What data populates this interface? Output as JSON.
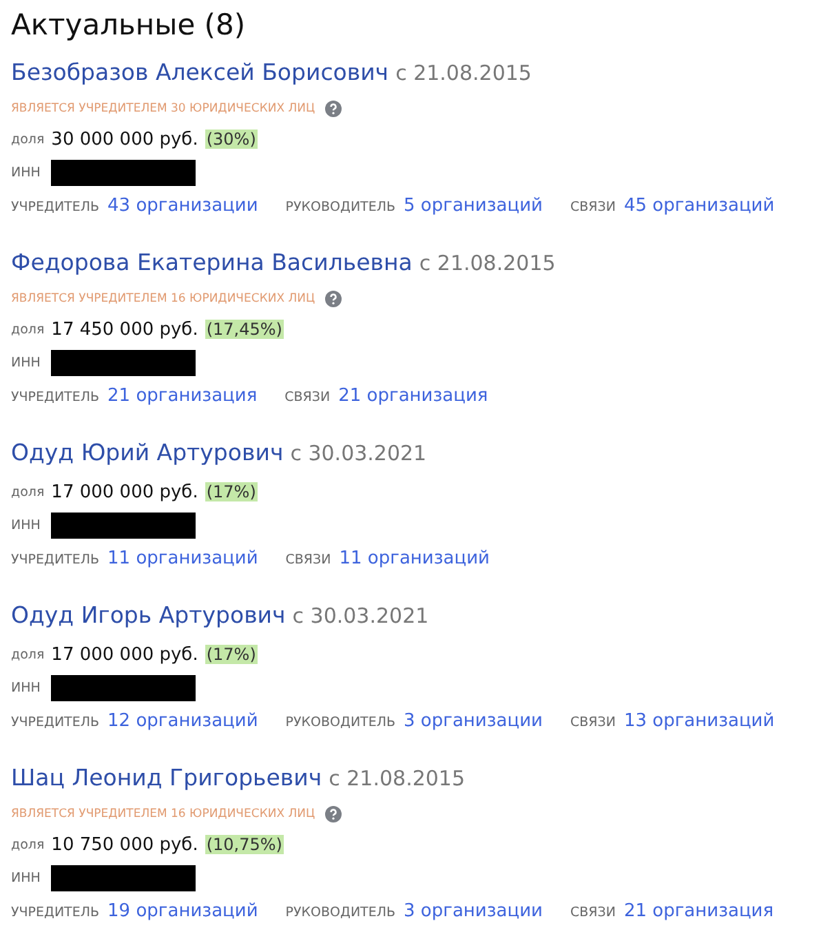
{
  "heading": "Актуальные (8)",
  "persons": [
    {
      "name": "Безобразов Алексей Борисович",
      "since": "с 21.08.2015",
      "note": "ЯВЛЯЕТСЯ УЧРЕДИТЕЛЕМ 30 ЮРИДИЧЕСКИХ ЛИЦ",
      "share_label": "доля",
      "share": "30 000 000 руб.",
      "percent": "(30%)",
      "inn_label": "ИНН",
      "inn_redacted": true,
      "links": [
        {
          "label": "УЧРЕДИТЕЛЬ",
          "value": "43 организации"
        },
        {
          "label": "РУКОВОДИТЕЛЬ",
          "value": "5 организаций"
        },
        {
          "label": "СВЯЗИ",
          "value": "45 организаций"
        }
      ]
    },
    {
      "name": "Федорова Екатерина Васильевна",
      "since": "с 21.08.2015",
      "note": "ЯВЛЯЕТСЯ УЧРЕДИТЕЛЕМ 16 ЮРИДИЧЕСКИХ ЛИЦ",
      "share_label": "доля",
      "share": "17 450 000 руб.",
      "percent": "(17,45%)",
      "inn_label": "ИНН",
      "inn_redacted": true,
      "links": [
        {
          "label": "УЧРЕДИТЕЛЬ",
          "value": "21 организация"
        },
        {
          "label": "СВЯЗИ",
          "value": "21 организация"
        }
      ]
    },
    {
      "name": "Одуд Юрий Артурович",
      "since": "с 30.03.2021",
      "share_label": "доля",
      "share": "17 000 000 руб.",
      "percent": "(17%)",
      "inn_label": "ИНН",
      "inn_redacted": true,
      "links": [
        {
          "label": "УЧРЕДИТЕЛЬ",
          "value": "11 организаций"
        },
        {
          "label": "СВЯЗИ",
          "value": "11 организаций"
        }
      ]
    },
    {
      "name": "Одуд Игорь Артурович",
      "since": "с 30.03.2021",
      "share_label": "доля",
      "share": "17 000 000 руб.",
      "percent": "(17%)",
      "inn_label": "ИНН",
      "inn_redacted": true,
      "links": [
        {
          "label": "УЧРЕДИТЕЛЬ",
          "value": "12 организаций"
        },
        {
          "label": "РУКОВОДИТЕЛЬ",
          "value": "3 организации"
        },
        {
          "label": "СВЯЗИ",
          "value": "13 организаций"
        }
      ]
    },
    {
      "name": "Шац Леонид Григорьевич",
      "since": "с 21.08.2015",
      "note": "ЯВЛЯЕТСЯ УЧРЕДИТЕЛЕМ 16 ЮРИДИЧЕСКИХ ЛИЦ",
      "share_label": "доля",
      "share": "10 750 000 руб.",
      "percent": "(10,75%)",
      "inn_label": "ИНН",
      "inn_redacted": true,
      "links": [
        {
          "label": "УЧРЕДИТЕЛЬ",
          "value": "19 организаций"
        },
        {
          "label": "РУКОВОДИТЕЛЬ",
          "value": "3 организации"
        },
        {
          "label": "СВЯЗИ",
          "value": "21 организация"
        }
      ]
    }
  ]
}
